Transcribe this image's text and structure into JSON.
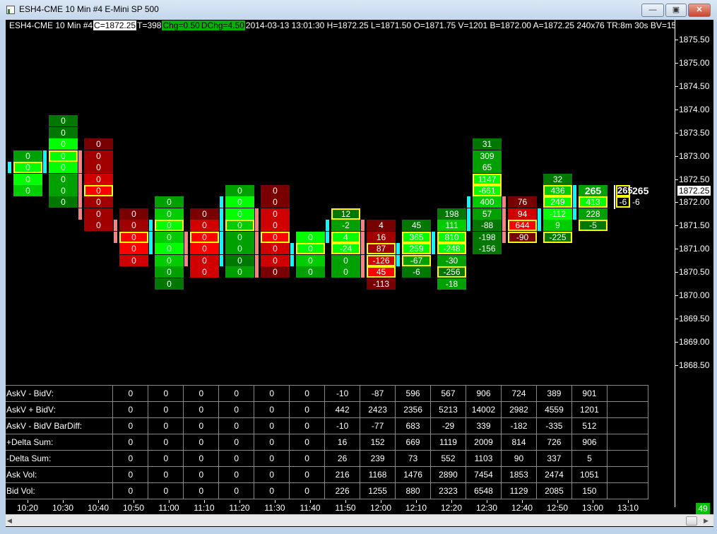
{
  "window": {
    "title": "ESH4-CME  10 Min  #4  E-Mini SP 500"
  },
  "info": {
    "prefix": "ESH4-CME  10 Min  #4",
    "close": "C=1872.25",
    "ticks": "T=398",
    "chg": "Chg=0.50",
    "dchg": "DChg=4.50",
    "rest": "2014-03-13 13:01:30 H=1872.25 L=1871.50 O=1871.75 V=1201 B=1872.00 A=1872.25 240x76 TR:8m 30s BV=150 AV=1051"
  },
  "colors": {
    "g1": "#007800",
    "g2": "#00a000",
    "g3": "#00cc00",
    "g4": "#00ff00",
    "r1": "#780000",
    "r2": "#a00000",
    "r3": "#d00000",
    "r4": "#ff0000",
    "cyan": "#00ffff",
    "pink": "#ff8080",
    "highlight": "#ffff00"
  },
  "chart_data": {
    "type": "footprint",
    "tick_size": 0.25,
    "ylim": [
      1868.25,
      1876.0
    ],
    "price_labels": [
      "1875.50",
      "1875.00",
      "1874.50",
      "1874.00",
      "1873.50",
      "1873.00",
      "1872.50",
      "1872.00",
      "1871.50",
      "1871.00",
      "1870.50",
      "1870.00",
      "1869.50",
      "1869.00",
      "1868.50"
    ],
    "current_price": "1872.25",
    "prev_bar_marker": {
      "color": "cyan",
      "prices": [
        1872.75
      ]
    },
    "bars": [
      {
        "time": "10:20",
        "cells": [
          [
            1873.0,
            "0",
            "g2",
            0
          ],
          [
            1872.75,
            "0",
            "g4",
            1
          ],
          [
            1872.5,
            "0",
            "g4",
            0
          ],
          [
            1872.25,
            "0",
            "g3",
            0
          ]
        ],
        "marker": {
          "color": "cyan",
          "prices": [
            1873.0,
            1872.75
          ]
        }
      },
      {
        "time": "10:30",
        "cells": [
          [
            1873.75,
            "0",
            "g1",
            0
          ],
          [
            1873.5,
            "0",
            "g1",
            0
          ],
          [
            1873.25,
            "0",
            "g4",
            0
          ],
          [
            1873.0,
            "0",
            "g4",
            1
          ],
          [
            1872.75,
            "0",
            "g4",
            0
          ],
          [
            1872.5,
            "0",
            "g2",
            0
          ],
          [
            1872.25,
            "0",
            "g2",
            0
          ],
          [
            1872.0,
            "0",
            "g1",
            0
          ]
        ],
        "marker": {
          "color": "pink",
          "prices": [
            1873.0,
            1872.75,
            1872.5,
            1872.25,
            1872.0,
            1871.75
          ]
        }
      },
      {
        "time": "10:40",
        "cells": [
          [
            1873.25,
            "0",
            "r1",
            0
          ],
          [
            1873.0,
            "0",
            "r2",
            0
          ],
          [
            1872.75,
            "0",
            "r2",
            0
          ],
          [
            1872.5,
            "0",
            "r3",
            0
          ],
          [
            1872.25,
            "0",
            "r4",
            1
          ],
          [
            1872.0,
            "0",
            "r2",
            0
          ],
          [
            1871.75,
            "0",
            "r2",
            0
          ],
          [
            1871.5,
            "0",
            "r2",
            0
          ]
        ],
        "marker": {
          "color": "pink",
          "prices": [
            1871.5,
            1871.25
          ]
        }
      },
      {
        "time": "10:50",
        "cells": [
          [
            1871.75,
            "0",
            "r1",
            0
          ],
          [
            1871.5,
            "0",
            "r2",
            0
          ],
          [
            1871.25,
            "0",
            "r4",
            1
          ],
          [
            1871.0,
            "0",
            "r4",
            0
          ],
          [
            1870.75,
            "0",
            "r3",
            0
          ]
        ],
        "marker": {
          "color": "cyan",
          "prices": [
            1871.5,
            1871.25,
            1871.0
          ]
        }
      },
      {
        "time": "11:00",
        "cells": [
          [
            1872.0,
            "0",
            "g2",
            0
          ],
          [
            1871.75,
            "0",
            "g3",
            0
          ],
          [
            1871.5,
            "0",
            "g4",
            1
          ],
          [
            1871.25,
            "0",
            "g3",
            0
          ],
          [
            1871.0,
            "0",
            "g4",
            0
          ],
          [
            1870.75,
            "0",
            "g3",
            0
          ],
          [
            1870.5,
            "0",
            "g2",
            0
          ],
          [
            1870.25,
            "0",
            "g1",
            0
          ]
        ],
        "marker": {
          "color": "pink",
          "prices": [
            1871.25,
            1871.0,
            1870.75
          ]
        }
      },
      {
        "time": "11:10",
        "cells": [
          [
            1871.75,
            "0",
            "r1",
            0
          ],
          [
            1871.5,
            "0",
            "r3",
            0
          ],
          [
            1871.25,
            "0",
            "r4",
            1
          ],
          [
            1871.0,
            "0",
            "r4",
            0
          ],
          [
            1870.75,
            "0",
            "r3",
            0
          ],
          [
            1870.5,
            "0",
            "r3",
            0
          ]
        ],
        "marker": {
          "color": "cyan",
          "prices": [
            1872.0,
            1871.75,
            1871.5,
            1871.25,
            1871.0,
            1870.75
          ]
        }
      },
      {
        "time": "11:20",
        "cells": [
          [
            1872.25,
            "0",
            "g2",
            0
          ],
          [
            1872.0,
            "0",
            "g4",
            0
          ],
          [
            1871.75,
            "0",
            "g4",
            0
          ],
          [
            1871.5,
            "0",
            "g3",
            1
          ],
          [
            1871.25,
            "0",
            "g2",
            0
          ],
          [
            1871.0,
            "0",
            "g2",
            0
          ],
          [
            1870.75,
            "0",
            "g1",
            0
          ],
          [
            1870.5,
            "0",
            "g2",
            0
          ]
        ],
        "marker": {
          "color": "pink",
          "prices": [
            1871.75,
            1871.5,
            1871.25,
            1871.0,
            1870.75,
            1870.5
          ]
        }
      },
      {
        "time": "11:30",
        "cells": [
          [
            1872.25,
            "0",
            "r1",
            0
          ],
          [
            1872.0,
            "0",
            "r1",
            0
          ],
          [
            1871.75,
            "0",
            "r3",
            0
          ],
          [
            1871.5,
            "0",
            "r3",
            0
          ],
          [
            1871.25,
            "0",
            "r4",
            1
          ],
          [
            1871.0,
            "0",
            "r3",
            0
          ],
          [
            1870.75,
            "0",
            "r3",
            0
          ],
          [
            1870.5,
            "0",
            "r1",
            0
          ]
        ],
        "marker": {
          "color": "cyan",
          "prices": [
            1871.0,
            1870.75
          ]
        }
      },
      {
        "time": "11:40",
        "cells": [
          [
            1871.25,
            "0",
            "g4",
            0
          ],
          [
            1871.0,
            "0",
            "g4",
            1
          ],
          [
            1870.75,
            "0",
            "g3",
            0
          ],
          [
            1870.5,
            "0",
            "g2",
            0
          ]
        ],
        "marker": {
          "color": "cyan",
          "prices": [
            1871.5,
            1871.25
          ]
        }
      },
      {
        "time": "11:50",
        "cells": [
          [
            1871.75,
            "12",
            "g1",
            1
          ],
          [
            1871.5,
            "-2",
            "g2",
            0
          ],
          [
            1871.25,
            "4",
            "g4",
            1
          ],
          [
            1871.0,
            "-24",
            "g4",
            1
          ],
          [
            1870.75,
            "0",
            "g2",
            0
          ],
          [
            1870.5,
            "0",
            "g2",
            0
          ]
        ],
        "marker": {
          "color": "pink",
          "prices": [
            1871.5,
            1871.25,
            1871.0,
            1870.75,
            1870.5
          ]
        }
      },
      {
        "time": "12:00",
        "cells": [
          [
            1871.5,
            "4",
            "r1",
            0
          ],
          [
            1871.25,
            "16",
            "r2",
            0
          ],
          [
            1871.0,
            "87",
            "r2",
            1
          ],
          [
            1870.75,
            "-126",
            "r3",
            1
          ],
          [
            1870.5,
            "45",
            "r4",
            1
          ],
          [
            1870.25,
            "-113",
            "r1",
            0
          ]
        ],
        "marker": {
          "color": "cyan",
          "prices": [
            1871.0,
            1870.75
          ]
        }
      },
      {
        "time": "12:10",
        "cells": [
          [
            1871.5,
            "45",
            "g1",
            0
          ],
          [
            1871.25,
            "365",
            "g4",
            1
          ],
          [
            1871.0,
            "259",
            "g4",
            1
          ],
          [
            1870.75,
            "-67",
            "g2",
            1
          ],
          [
            1870.5,
            "-6",
            "g1",
            0
          ]
        ],
        "marker": {
          "color": "cyan",
          "prices": [
            1871.25,
            1871.0
          ]
        }
      },
      {
        "time": "12:20",
        "cells": [
          [
            1871.75,
            "198",
            "g1",
            0
          ],
          [
            1871.5,
            "111",
            "g3",
            0
          ],
          [
            1871.25,
            "810",
            "g4",
            1
          ],
          [
            1871.0,
            "-248",
            "g4",
            1
          ],
          [
            1870.75,
            "-30",
            "g2",
            0
          ],
          [
            1870.5,
            "-256",
            "g1",
            1
          ],
          [
            1870.25,
            "-18",
            "g2",
            0
          ]
        ],
        "marker": {
          "color": "cyan",
          "prices": [
            1872.0,
            1871.75,
            1871.5
          ]
        }
      },
      {
        "time": "12:30",
        "cells": [
          [
            1873.25,
            "31",
            "g1",
            0
          ],
          [
            1873.0,
            "309",
            "g2",
            0
          ],
          [
            1872.75,
            "65",
            "g2",
            0
          ],
          [
            1872.5,
            "1147",
            "g4",
            1
          ],
          [
            1872.25,
            "-661",
            "g4",
            1
          ],
          [
            1872.0,
            "400",
            "g3",
            0
          ],
          [
            1871.75,
            "57",
            "g2",
            0
          ],
          [
            1871.5,
            "-88",
            "g1",
            0
          ],
          [
            1871.25,
            "-198",
            "g1",
            0
          ],
          [
            1871.0,
            "-156",
            "g1",
            0
          ]
        ],
        "marker": {
          "color": "pink",
          "prices": [
            1872.0,
            1871.75,
            1871.5,
            1871.25
          ]
        }
      },
      {
        "time": "12:40",
        "cells": [
          [
            1872.0,
            "76",
            "r1",
            0
          ],
          [
            1871.75,
            "94",
            "r3",
            0
          ],
          [
            1871.5,
            "644",
            "r4",
            1
          ],
          [
            1871.25,
            "-90",
            "r1",
            1
          ]
        ],
        "marker": {
          "color": "cyan",
          "prices": [
            1871.75,
            1871.5
          ]
        }
      },
      {
        "time": "12:50",
        "cells": [
          [
            1872.5,
            "32",
            "g1",
            0
          ],
          [
            1872.25,
            "436",
            "g3",
            1
          ],
          [
            1872.0,
            "249",
            "g4",
            1
          ],
          [
            1871.75,
            "-112",
            "g4",
            0
          ],
          [
            1871.5,
            "9",
            "g3",
            0
          ],
          [
            1871.25,
            "-225",
            "g1",
            1
          ]
        ],
        "marker": {
          "color": "cyan",
          "prices": [
            1872.25,
            1872.0,
            1871.75
          ]
        }
      },
      {
        "time": "13:00",
        "cells": [
          [
            1872.25,
            "265",
            "g2",
            0
          ],
          [
            1872.0,
            "413",
            "g4",
            1
          ],
          [
            1871.75,
            "228",
            "g2",
            0
          ],
          [
            1871.5,
            "-5",
            "g1",
            1
          ]
        ]
      },
      {
        "time": "13:10",
        "cells": []
      }
    ],
    "live": {
      "volume": "265",
      "delta": "-6",
      "volume_price": 1872.25,
      "delta_price": 1872.0
    }
  },
  "table": {
    "rows": [
      {
        "label": "AskV - BidV:",
        "values": [
          "0",
          "0",
          "0",
          "0",
          "0",
          "0",
          "-10",
          "-87",
          "596",
          "567",
          "906",
          "724",
          "389",
          "901"
        ]
      },
      {
        "label": "AskV + BidV:",
        "values": [
          "0",
          "0",
          "0",
          "0",
          "0",
          "0",
          "442",
          "2423",
          "2356",
          "5213",
          "14002",
          "2982",
          "4559",
          "1201"
        ]
      },
      {
        "label": "AskV - BidV BarDiff:",
        "values": [
          "0",
          "0",
          "0",
          "0",
          "0",
          "0",
          "-10",
          "-77",
          "683",
          "-29",
          "339",
          "-182",
          "-335",
          "512"
        ]
      },
      {
        "label": "+Delta Sum:",
        "values": [
          "0",
          "0",
          "0",
          "0",
          "0",
          "0",
          "16",
          "152",
          "669",
          "1119",
          "2009",
          "814",
          "726",
          "906"
        ]
      },
      {
        "label": "-Delta Sum:",
        "values": [
          "0",
          "0",
          "0",
          "0",
          "0",
          "0",
          "26",
          "239",
          "73",
          "552",
          "1103",
          "90",
          "337",
          "5"
        ]
      },
      {
        "label": "Ask Vol:",
        "values": [
          "0",
          "0",
          "0",
          "0",
          "0",
          "0",
          "216",
          "1168",
          "1476",
          "2890",
          "7454",
          "1853",
          "2474",
          "1051"
        ]
      },
      {
        "label": "Bid Vol:",
        "values": [
          "0",
          "0",
          "0",
          "0",
          "0",
          "0",
          "226",
          "1255",
          "880",
          "2323",
          "6548",
          "1129",
          "2085",
          "150"
        ]
      }
    ]
  },
  "status": {
    "count": "49"
  }
}
